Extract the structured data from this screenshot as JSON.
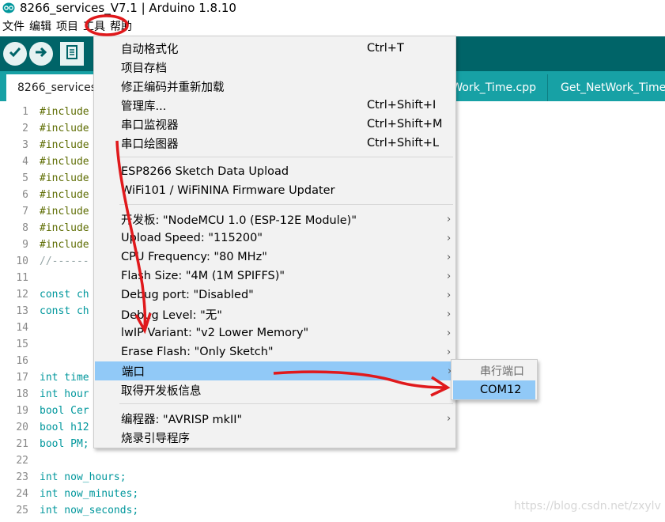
{
  "window": {
    "title": "8266_services_V7.1 | Arduino 1.8.10"
  },
  "menubar": {
    "items": [
      "文件",
      "编辑",
      "项目",
      "工具",
      "帮助"
    ]
  },
  "toolbar": {
    "verify_icon": "check-icon",
    "upload_icon": "arrow-right-icon",
    "new_icon": "document-icon"
  },
  "tabs": [
    {
      "label": "8266_services"
    },
    {
      "label": "Work_Time.cpp"
    },
    {
      "label": "Get_NetWork_Time."
    }
  ],
  "editor": {
    "lines": [
      {
        "num": "1",
        "text": "#include",
        "kind": "pre"
      },
      {
        "num": "2",
        "text": "#include",
        "kind": "pre"
      },
      {
        "num": "3",
        "text": "#include",
        "kind": "pre"
      },
      {
        "num": "4",
        "text": "#include",
        "kind": "pre"
      },
      {
        "num": "5",
        "text": "#include",
        "kind": "pre"
      },
      {
        "num": "6",
        "text": "#include",
        "kind": "pre"
      },
      {
        "num": "7",
        "text": "#include",
        "kind": "pre"
      },
      {
        "num": "8",
        "text": "#include",
        "kind": "pre"
      },
      {
        "num": "9",
        "text": "#include",
        "kind": "pre"
      },
      {
        "num": "10",
        "text": "//------",
        "kind": "com"
      },
      {
        "num": "11",
        "text": "",
        "kind": "txt"
      },
      {
        "num": "12",
        "text": "const ch",
        "kind": "kw"
      },
      {
        "num": "13",
        "text": "const ch",
        "kind": "kw"
      },
      {
        "num": "14",
        "text": "",
        "kind": "txt"
      },
      {
        "num": "15",
        "text": "",
        "kind": "txt"
      },
      {
        "num": "16",
        "text": "",
        "kind": "txt"
      },
      {
        "num": "17",
        "text": "int time",
        "kind": "kw"
      },
      {
        "num": "18",
        "text": "int hour",
        "kind": "kw"
      },
      {
        "num": "19",
        "text": "bool Cer",
        "kind": "kw"
      },
      {
        "num": "20",
        "text": "bool h12",
        "kind": "kw"
      },
      {
        "num": "21",
        "text": "bool PM;",
        "kind": "kw"
      },
      {
        "num": "22",
        "text": "",
        "kind": "txt"
      },
      {
        "num": "23",
        "text": "int now_hours;",
        "kind": "kw"
      },
      {
        "num": "24",
        "text": "int now_minutes;",
        "kind": "kw"
      },
      {
        "num": "25",
        "text": "int now_seconds;",
        "kind": "kw"
      }
    ]
  },
  "tools_menu": {
    "items": [
      {
        "label": "自动格式化",
        "shortcut": "Ctrl+T"
      },
      {
        "label": "项目存档",
        "shortcut": ""
      },
      {
        "label": "修正编码并重新加载",
        "shortcut": ""
      },
      {
        "label": "管理库...",
        "shortcut": "Ctrl+Shift+I"
      },
      {
        "label": "串口监视器",
        "shortcut": "Ctrl+Shift+M"
      },
      {
        "label": "串口绘图器",
        "shortcut": "Ctrl+Shift+L"
      },
      {
        "label": "ESP8266 Sketch Data Upload",
        "shortcut": ""
      },
      {
        "label": "WiFi101 / WiFiNINA Firmware Updater",
        "shortcut": ""
      },
      {
        "label": "开发板: \"NodeMCU 1.0 (ESP-12E Module)\"",
        "shortcut": ""
      },
      {
        "label": "Upload Speed: \"115200\"",
        "shortcut": ""
      },
      {
        "label": "CPU Frequency: \"80 MHz\"",
        "shortcut": ""
      },
      {
        "label": "Flash Size: \"4M (1M SPIFFS)\"",
        "shortcut": ""
      },
      {
        "label": "Debug port: \"Disabled\"",
        "shortcut": ""
      },
      {
        "label": "Debug Level: \"无\"",
        "shortcut": ""
      },
      {
        "label": "lwIP Variant: \"v2 Lower Memory\"",
        "shortcut": ""
      },
      {
        "label": "Erase Flash: \"Only Sketch\"",
        "shortcut": ""
      },
      {
        "label": "端口",
        "shortcut": ""
      },
      {
        "label": "取得开发板信息",
        "shortcut": ""
      },
      {
        "label": "编程器: \"AVRISP mkII\"",
        "shortcut": ""
      },
      {
        "label": "烧录引导程序",
        "shortcut": ""
      }
    ]
  },
  "port_submenu": {
    "header": "串行端口",
    "item": "COM12"
  },
  "watermark": "https://blog.csdn.net/zxylv",
  "colors": {
    "toolbar": "#006468",
    "tabbar": "#17a1a5",
    "highlight": "#91c9f7",
    "annotation": "#e0191c"
  }
}
